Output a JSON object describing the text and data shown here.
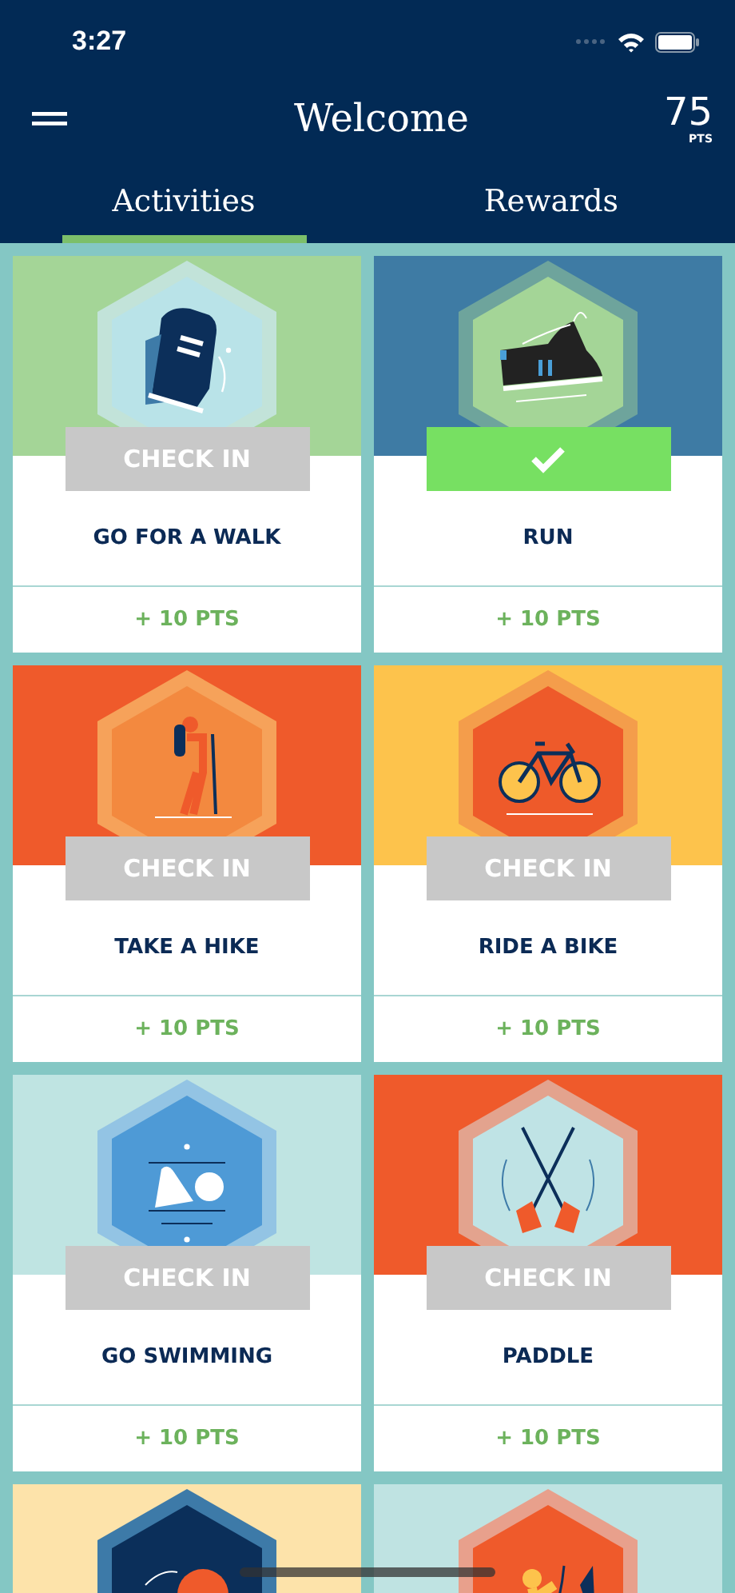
{
  "status_bar": {
    "time": "3:27"
  },
  "header": {
    "title": "Welcome",
    "points": "75",
    "points_unit": "PTS"
  },
  "tabs": [
    {
      "label": "Activities",
      "selected": true
    },
    {
      "label": "Rewards",
      "selected": false
    }
  ],
  "activities": [
    {
      "kind": "walk",
      "color": "#a4d597",
      "button_label": "CHECK IN",
      "checked": false,
      "name": "GO FOR A WALK",
      "points": "+ 10 PTS"
    },
    {
      "kind": "run",
      "color": "#3e7ba4",
      "checked": true,
      "name": "RUN",
      "points": "+ 10 PTS"
    },
    {
      "kind": "hike",
      "color": "#ef5a2b",
      "button_label": "CHECK IN",
      "checked": false,
      "name": "TAKE A HIKE",
      "points": "+ 10 PTS"
    },
    {
      "kind": "bike",
      "color": "#fdc34c",
      "button_label": "CHECK IN",
      "checked": false,
      "name": "RIDE A BIKE",
      "points": "+ 10 PTS"
    },
    {
      "kind": "swim",
      "color": "#bfe4e2",
      "button_label": "CHECK IN",
      "checked": false,
      "name": "GO SWIMMING",
      "points": "+ 10 PTS"
    },
    {
      "kind": "paddle",
      "color": "#ef5a2b",
      "button_label": "CHECK IN",
      "checked": false,
      "name": "PADDLE",
      "points": "+ 10 PTS"
    },
    {
      "kind": "balls",
      "color": "#fde3aa"
    },
    {
      "kind": "climb",
      "color": "#bfe3e2"
    }
  ]
}
